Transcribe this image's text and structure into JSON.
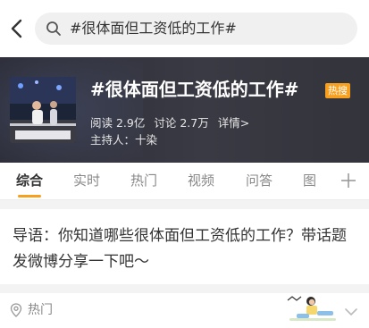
{
  "header": {
    "search_text": "#很体面但工资低的工作#"
  },
  "topic": {
    "title": "#很体面但工资低的工作#",
    "badge": "热搜",
    "reads": "阅读 2.9亿",
    "discussions": "讨论 2.7万",
    "details": "详情>",
    "host": "主持人：十染"
  },
  "tabs": [
    {
      "label": "综合"
    },
    {
      "label": "实时"
    },
    {
      "label": "热门"
    },
    {
      "label": "视频"
    },
    {
      "label": "问答"
    },
    {
      "label": "图"
    }
  ],
  "guide_text": "导语：你知道哪些很体面但工资低的工作？带话题发微博分享一下吧～",
  "section": {
    "hot_label": "热门"
  },
  "colors": {
    "accent": "#f7a01f",
    "hero_bg": "#33333b"
  }
}
